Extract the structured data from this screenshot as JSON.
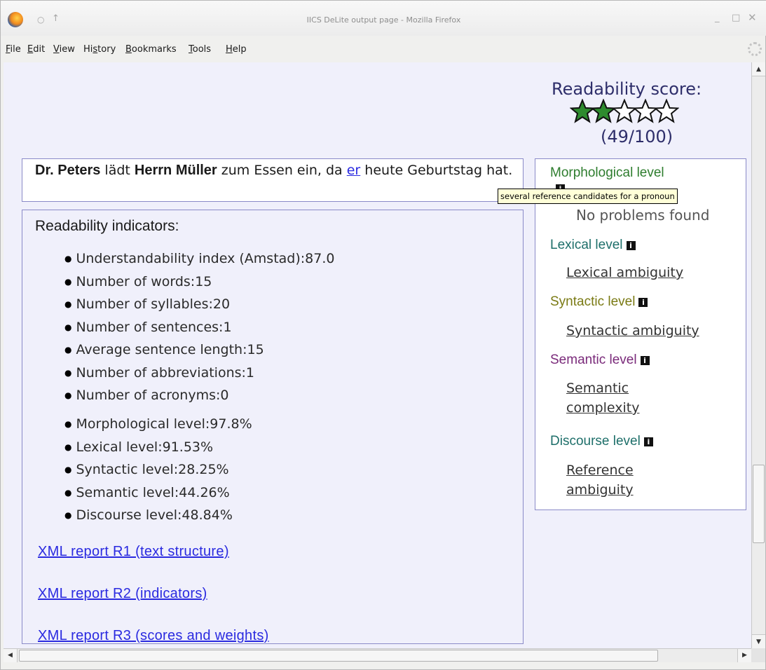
{
  "window": {
    "title": "IICS DeLite output page - Mozilla Firefox",
    "controls": {
      "minimize": "_",
      "maximize": "□",
      "close": "✕"
    }
  },
  "menu": [
    {
      "pre": "",
      "u": "F",
      "post": "ile"
    },
    {
      "pre": "",
      "u": "E",
      "post": "dit"
    },
    {
      "pre": "",
      "u": "V",
      "post": "iew"
    },
    {
      "pre": "Hi",
      "u": "s",
      "post": "tory"
    },
    {
      "pre": "",
      "u": "B",
      "post": "ookmarks"
    },
    {
      "pre": "",
      "u": "T",
      "post": "ools"
    },
    {
      "pre": "",
      "u": "H",
      "post": "elp"
    }
  ],
  "score": {
    "title": "Readability score:",
    "value_text": "(49/100)",
    "stars_filled": 2,
    "stars_total": 5,
    "star_fill_color": "#2e8b2e",
    "star_empty_color": "#ffffff"
  },
  "sentence": {
    "entity1": "Dr. Peters",
    "text1": " lädt ",
    "entity2": "Herrn Müller",
    "text2": " zum Essen ein, da ",
    "pronoun": "er",
    "text3": " heute Geburtstag hat."
  },
  "tooltip": "several reference candidates for a pronoun",
  "indicators": {
    "title": "Readability indicators:",
    "general": [
      "Understandability index (Amstad):87.0",
      "Number of words:15",
      "Number of syllables:20",
      "Number of sentences:1",
      "Average sentence length:15",
      "Number of abbreviations:1",
      "Number of acronyms:0"
    ],
    "levels": [
      "Morphological level:97.8%",
      "Lexical level:91.53%",
      "Syntactic level:28.25%",
      "Semantic level:44.26%",
      "Discourse level:48.84%"
    ],
    "links": {
      "r1": "XML report R1 (text structure)",
      "r2": "XML report R2 (indicators)",
      "r3": "XML report R3 (scores and weights)"
    }
  },
  "levels_panel": {
    "morphological": {
      "title": "Morphological level",
      "color": "#2e7d2e",
      "item": "No problems found"
    },
    "lexical": {
      "title": "Lexical level",
      "color": "#1e6f6a",
      "item": "Lexical ambiguity"
    },
    "syntactic": {
      "title": "Syntactic level",
      "color": "#7a7a14",
      "item": "Syntactic ambiguity"
    },
    "semantic": {
      "title": "Semantic level",
      "color": "#7a2a7a",
      "item": "Semantic complexity"
    },
    "discourse": {
      "title": "Discourse level",
      "color": "#1e6f6a",
      "item": "Reference ambiguity"
    }
  }
}
